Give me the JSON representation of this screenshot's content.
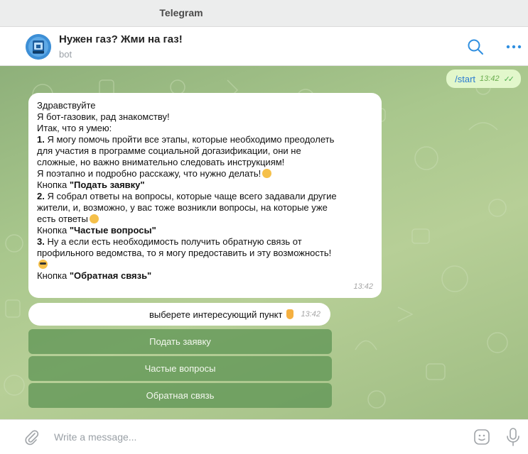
{
  "window": {
    "title": "Telegram"
  },
  "chat": {
    "title": "Нужен газ? Жми на газ!",
    "subtitle": "bot"
  },
  "colors": {
    "accent": "#3d8fd6",
    "outgoing_bubble": "#e2f7cb",
    "keyboard_button": "#6a9a58"
  },
  "icons": {
    "header": [
      "search-icon",
      "more-icon"
    ],
    "composer": [
      "attach-icon",
      "emoji-sticker-icon",
      "microphone-icon"
    ]
  },
  "messages": {
    "outgoing": {
      "text": "/start",
      "time": "13:42",
      "status": "read"
    },
    "incoming": {
      "lines": [
        "Здравствуйте",
        "Я бот-газовик, рад знакомству!",
        "Итак, что я умею:",
        " Я могу помочь пройти все этапы, которые необходимо преодолеть",
        "для участия в программе социальной догазификации, они не",
        "сложные, но важно внимательно следовать инструкциям!",
        "Я поэтапно и подробно расскажу, что нужно делать!",
        "Кнопка ",
        " Я собрал ответы на вопросы, которые чаще всего задавали другие",
        "жители, и, возможно, у вас тоже возникли вопросы, на которые уже",
        "есть ответы",
        "Кнопка ",
        " Ну а если есть необходимость получить обратную связь от",
        "профильного ведомства, то я могу предоставить и эту возможность!",
        "Кнопка "
      ],
      "numbers": [
        "1.",
        "2.",
        "3."
      ],
      "button_names": [
        "\"Подать заявку\"",
        "\"Частые вопросы\"",
        "\"Обратная связь\""
      ],
      "time": "13:42"
    },
    "prompt": {
      "text": "выберете интересующий пункт",
      "time": "13:42"
    }
  },
  "keyboard": {
    "buttons": [
      "Подать заявку",
      "Частые вопросы",
      "Обратная связь"
    ]
  },
  "composer": {
    "placeholder": "Write a message...",
    "value": ""
  }
}
